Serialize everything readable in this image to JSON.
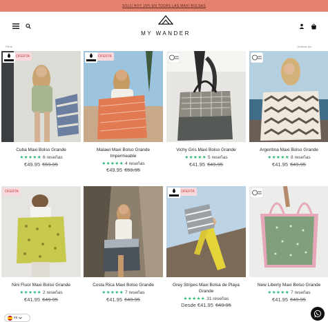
{
  "announcement": "SOLO HOY 15% EN TODAS LAS MAXI BOLSAS",
  "header": {
    "brand": "MY WANDER",
    "menu_icon": "hamburger-icon",
    "search_icon": "search-icon",
    "account_icon": "user-icon",
    "cart_icon": "bag-icon"
  },
  "sortbar": {
    "left": "Filtrar",
    "right": "Ordenar por"
  },
  "colors": {
    "announcement_bg": "#e5826f",
    "stars": "#2bb673"
  },
  "products": [
    {
      "title": "Cuba Maxi Bolso Grande",
      "reviews": "6 reseñas",
      "price": "€49.95",
      "compare": "€59.95",
      "badge": "OFERTA",
      "label": "WATER REPELLENT"
    },
    {
      "title": "Malawi Maxi Bolso Grande Impermeable",
      "reviews": "4 reseñas",
      "price": "€49.95",
      "compare": "€59.95",
      "badge": "OFERTA",
      "label": "WATER REPELLENT"
    },
    {
      "title": "Vichy Gris Maxi Bolso Grande",
      "reviews": "5 reseñas",
      "price": "€41.95",
      "compare": "€49.95",
      "badge": "",
      "label": "RECYCLED"
    },
    {
      "title": "Argentina Maxi Bolso Grande",
      "reviews": "8 reseñas",
      "price": "€41.95",
      "compare": "€49.95",
      "badge": "",
      "label": "RECYCLED"
    },
    {
      "title": "Nini Fluor Maxi Bolso Grande",
      "reviews": "2 reseñas",
      "price": "€41.95",
      "compare": "€49.95",
      "badge": "OFERTA",
      "label": ""
    },
    {
      "title": "Costa Rica Maxi Bolso Grande",
      "reviews": "7 reseñas",
      "price": "€41.95",
      "compare": "€49.95",
      "badge": "",
      "label": "RECYCLED"
    },
    {
      "title": "Grey Stripes Maxi Bolsa de Playa Grande",
      "reviews": "31 reseñas",
      "price": "Desde €41.95",
      "compare": "€49.95",
      "badge": "OFERTA",
      "label": "WATER REPELLENT"
    },
    {
      "title": "New Liberty Maxi Bolso Grande",
      "reviews": "7 reseñas",
      "price": "€41.95",
      "compare": "€49.95",
      "badge": "",
      "label": "RECYCLED"
    }
  ],
  "stars_glyph": "★★★★★",
  "language": {
    "code": "es",
    "icon": "flag-spain-icon"
  },
  "whatsapp_icon": "whatsapp-icon"
}
